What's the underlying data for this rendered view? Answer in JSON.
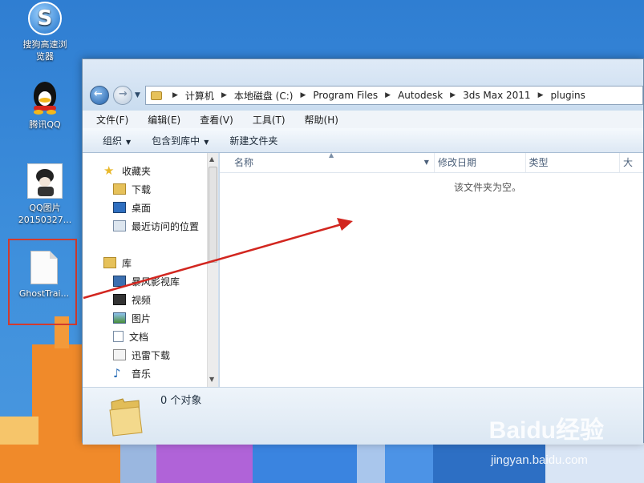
{
  "desktop": {
    "icons": [
      {
        "label_line1": "搜狗高速浏",
        "label_line2": "览器"
      },
      {
        "label_line1": "腾讯QQ",
        "label_line2": ""
      },
      {
        "label_line1": "QQ图片",
        "label_line2": "20150327..."
      },
      {
        "label_line1": "GhostTrai...",
        "label_line2": ""
      }
    ]
  },
  "explorer": {
    "breadcrumbs": [
      "计算机",
      "本地磁盘 (C:)",
      "Program Files",
      "Autodesk",
      "3ds Max 2011",
      "plugins"
    ],
    "menu": [
      "文件(F)",
      "编辑(E)",
      "查看(V)",
      "工具(T)",
      "帮助(H)"
    ],
    "toolbar": {
      "organize": "组织",
      "include_in_library": "包含到库中",
      "new_folder": "新建文件夹"
    },
    "nav": {
      "favorites": "收藏夹",
      "downloads": "下载",
      "desktop": "桌面",
      "recent": "最近访问的位置",
      "libraries": "库",
      "storm": "暴风影视库",
      "videos": "视频",
      "pictures": "图片",
      "documents": "文档",
      "thunder": "迅雷下载",
      "music": "音乐"
    },
    "columns": [
      "名称",
      "修改日期",
      "类型",
      "大"
    ],
    "empty_text": "该文件夹为空。",
    "status": "0 个对象"
  },
  "watermark": {
    "brand": "Baidu经验",
    "url": "jingyan.baidu.com"
  },
  "colors": {
    "selection_box": "#d23a2e",
    "annotation_arrow": "#d2261f"
  }
}
